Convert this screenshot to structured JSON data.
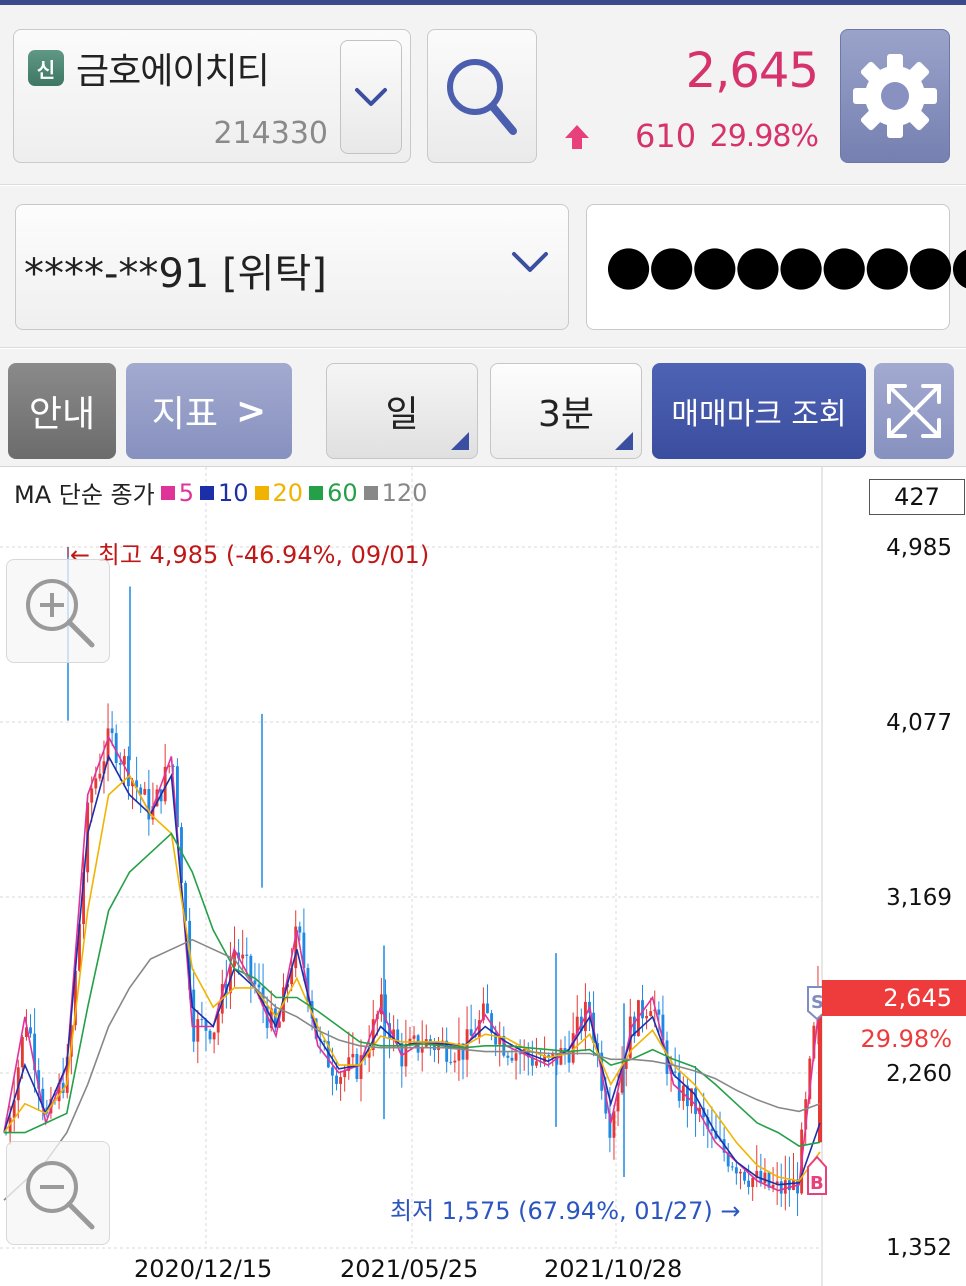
{
  "stock": {
    "badge": "신",
    "name": "금호에이치티",
    "code": "214330",
    "price": "2,645",
    "change": "610",
    "rate": "29.98%"
  },
  "account": {
    "number": "****-**91 [위탁]",
    "password_mask": "●●●●●●●●●"
  },
  "toolbar": {
    "guide": "안내",
    "indicator": "지표",
    "indicator_arrow": ">",
    "period": "일",
    "interval": "3분",
    "trade_mark": "매매마크 조회"
  },
  "chart": {
    "legend_title": "MA 단순 종가",
    "legend": [
      {
        "label": "5",
        "color": "#e0339a"
      },
      {
        "label": "10",
        "color": "#1d2fa8"
      },
      {
        "label": "20",
        "color": "#f0b400"
      },
      {
        "label": "60",
        "color": "#24a148"
      },
      {
        "label": "120",
        "color": "#888888"
      }
    ],
    "volume_box": "427",
    "high_label": "← 최고 4,985 (-46.94%, 09/01)",
    "low_label": "최저 1,575 (67.94%, 01/27) →",
    "current_price": "2,645",
    "current_rate": "29.98%",
    "sell_marker": "S",
    "buy_marker": "B"
  },
  "chart_data": {
    "type": "line",
    "title": "",
    "xlabel": "",
    "ylabel": "",
    "y_ticks": [
      "4,985",
      "4,077",
      "3,169",
      "2,260",
      "1,352"
    ],
    "x_ticks": [
      "2020/12/15",
      "2021/05/25",
      "2021/10/28"
    ],
    "ylim": [
      1352,
      4985
    ],
    "high": 4985,
    "low": 1575,
    "last": 2645,
    "series": [
      {
        "name": "5",
        "values": [
          1950,
          2550,
          2000,
          2300,
          3700,
          4000,
          3800,
          3600,
          3900,
          2500,
          2500,
          2900,
          2700,
          2450,
          3000,
          2400,
          2260,
          2300,
          2600,
          2350,
          2420,
          2400,
          2380,
          2560,
          2400,
          2350,
          2300,
          2380,
          2600,
          2000,
          2500,
          2650,
          2200,
          2100,
          1900,
          1800,
          1700,
          1650,
          1680,
          2645
        ]
      },
      {
        "name": "10",
        "values": [
          1950,
          2300,
          2050,
          2300,
          3500,
          3900,
          3700,
          3600,
          3800,
          2600,
          2500,
          2800,
          2700,
          2500,
          2900,
          2450,
          2280,
          2300,
          2500,
          2400,
          2420,
          2410,
          2400,
          2500,
          2420,
          2360,
          2320,
          2380,
          2550,
          2100,
          2450,
          2550,
          2250,
          2150,
          1950,
          1800,
          1720,
          1680,
          1690,
          2000
        ]
      },
      {
        "name": "20",
        "values": [
          1950,
          2100,
          2050,
          2200,
          3100,
          3700,
          3800,
          3600,
          3500,
          2800,
          2600,
          2700,
          2700,
          2550,
          2750,
          2500,
          2300,
          2300,
          2450,
          2420,
          2420,
          2420,
          2400,
          2460,
          2440,
          2380,
          2340,
          2360,
          2460,
          2200,
          2380,
          2480,
          2300,
          2200,
          2050,
          1900,
          1780,
          1720,
          1700,
          1850
        ]
      },
      {
        "name": "60",
        "values": [
          1950,
          1950,
          2000,
          2050,
          2600,
          3100,
          3300,
          3400,
          3500,
          3300,
          3000,
          2800,
          2750,
          2650,
          2650,
          2580,
          2500,
          2420,
          2400,
          2400,
          2410,
          2400,
          2390,
          2400,
          2400,
          2390,
          2380,
          2370,
          2380,
          2300,
          2330,
          2380,
          2330,
          2290,
          2200,
          2100,
          2000,
          1950,
          1880,
          1900
        ]
      },
      {
        "name": "120",
        "values": [
          1600,
          1700,
          1800,
          1950,
          2200,
          2500,
          2700,
          2850,
          2900,
          2950,
          2900,
          2850,
          2700,
          2600,
          2550,
          2480,
          2430,
          2400,
          2390,
          2390,
          2390,
          2390,
          2380,
          2370,
          2370,
          2370,
          2360,
          2360,
          2360,
          2330,
          2330,
          2320,
          2300,
          2270,
          2230,
          2170,
          2120,
          2080,
          2060,
          2100
        ]
      }
    ]
  },
  "colors": {
    "up": "#d6336c",
    "brand": "#3b4a8c",
    "candle_up": "#e53935",
    "candle_down": "#1e88e5"
  }
}
